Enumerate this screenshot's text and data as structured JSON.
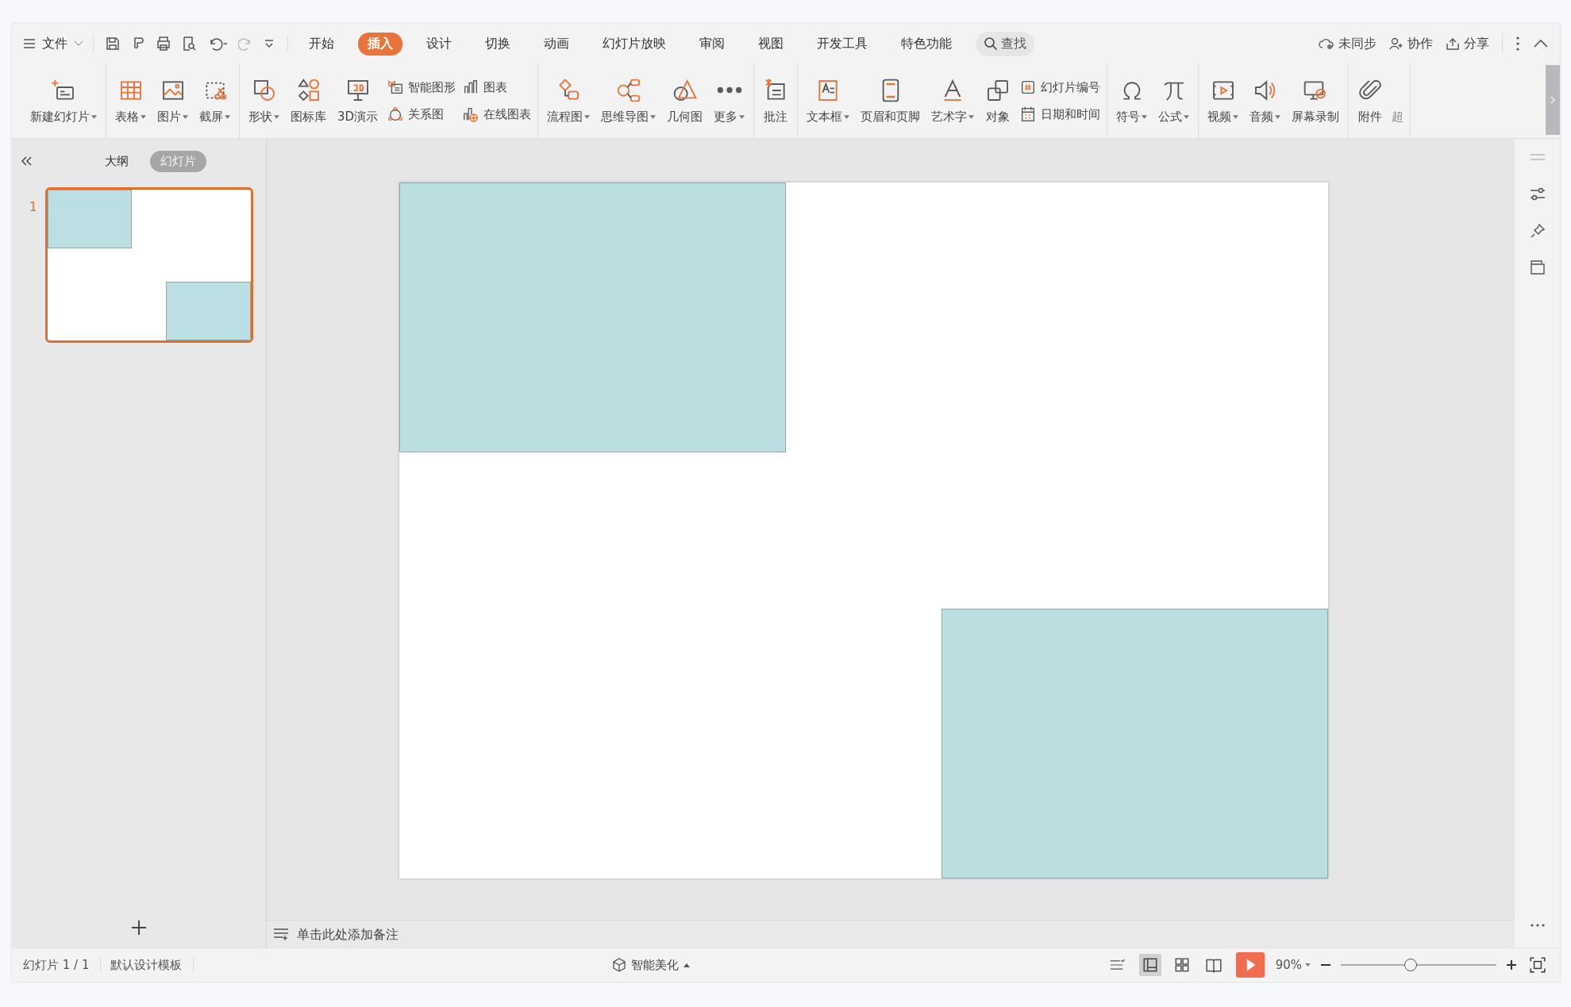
{
  "menu": {
    "file": "文件",
    "tabs": [
      {
        "label": "开始",
        "selected": false
      },
      {
        "label": "插入",
        "selected": true
      },
      {
        "label": "设计",
        "selected": false
      },
      {
        "label": "切换",
        "selected": false
      },
      {
        "label": "动画",
        "selected": false
      },
      {
        "label": "幻灯片放映",
        "selected": false
      },
      {
        "label": "审阅",
        "selected": false
      },
      {
        "label": "视图",
        "selected": false
      },
      {
        "label": "开发工具",
        "selected": false
      },
      {
        "label": "特色功能",
        "selected": false
      }
    ],
    "search": "查找",
    "actions": [
      "未同步",
      "协作",
      "分享"
    ]
  },
  "ribbon": {
    "groups": [
      {
        "columns": [
          {
            "kind": "large",
            "label": "新建幻灯片",
            "dropdown": true
          }
        ]
      },
      {
        "columns": [
          {
            "kind": "large",
            "label": "表格",
            "dropdown": true
          },
          {
            "kind": "large",
            "label": "图片",
            "dropdown": true
          },
          {
            "kind": "large",
            "label": "截屏",
            "dropdown": true
          }
        ]
      },
      {
        "columns": [
          {
            "kind": "large",
            "label": "形状",
            "dropdown": true
          },
          {
            "kind": "large",
            "label": "图标库",
            "dropdown": false
          },
          {
            "kind": "large",
            "label": "3D演示",
            "dropdown": false
          },
          {
            "kind": "stack",
            "items": [
              {
                "label": "智能图形"
              },
              {
                "label": "关系图"
              }
            ]
          },
          {
            "kind": "stack",
            "items": [
              {
                "label": "图表"
              },
              {
                "label": "在线图表"
              }
            ]
          }
        ]
      },
      {
        "columns": [
          {
            "kind": "large",
            "label": "流程图",
            "dropdown": true
          },
          {
            "kind": "large",
            "label": "思维导图",
            "dropdown": true
          },
          {
            "kind": "large",
            "label": "几何图",
            "dropdown": false
          },
          {
            "kind": "large",
            "label": "更多",
            "dropdown": true
          }
        ]
      },
      {
        "columns": [
          {
            "kind": "large",
            "label": "批注",
            "dropdown": false
          }
        ]
      },
      {
        "columns": [
          {
            "kind": "large",
            "label": "文本框",
            "dropdown": true
          },
          {
            "kind": "large",
            "label": "页眉和页脚",
            "dropdown": false
          },
          {
            "kind": "large",
            "label": "艺术字",
            "dropdown": true
          },
          {
            "kind": "large",
            "label": "对象",
            "dropdown": false
          },
          {
            "kind": "stack",
            "items": [
              {
                "label": "幻灯片编号"
              },
              {
                "label": "日期和时间"
              }
            ]
          }
        ]
      },
      {
        "columns": [
          {
            "kind": "large",
            "label": "符号",
            "dropdown": true
          },
          {
            "kind": "large",
            "label": "公式",
            "dropdown": true
          }
        ]
      },
      {
        "columns": [
          {
            "kind": "large",
            "label": "视频",
            "dropdown": true
          },
          {
            "kind": "large",
            "label": "音频",
            "dropdown": true
          },
          {
            "kind": "large",
            "label": "屏幕录制",
            "dropdown": false
          }
        ]
      },
      {
        "columns": [
          {
            "kind": "large",
            "label": "附件",
            "dropdown": false
          },
          {
            "kind": "cut",
            "label": "超"
          }
        ]
      }
    ]
  },
  "panel": {
    "tabs": [
      {
        "label": "大纲",
        "selected": false
      },
      {
        "label": "幻灯片",
        "selected": true
      }
    ],
    "slides": [
      {
        "number": "1",
        "selected": true
      }
    ]
  },
  "slide": {
    "shapes": [
      {
        "kind": "rectangle"
      },
      {
        "kind": "rectangle"
      }
    ]
  },
  "notes": {
    "placeholder": "单击此处添加备注"
  },
  "status_bar": {
    "slide": "幻灯片 1 / 1",
    "template": "默认设计模板",
    "beautify": "智能美化",
    "zoom": "90%",
    "zoom_slider": {
      "level": 0.45
    }
  }
}
